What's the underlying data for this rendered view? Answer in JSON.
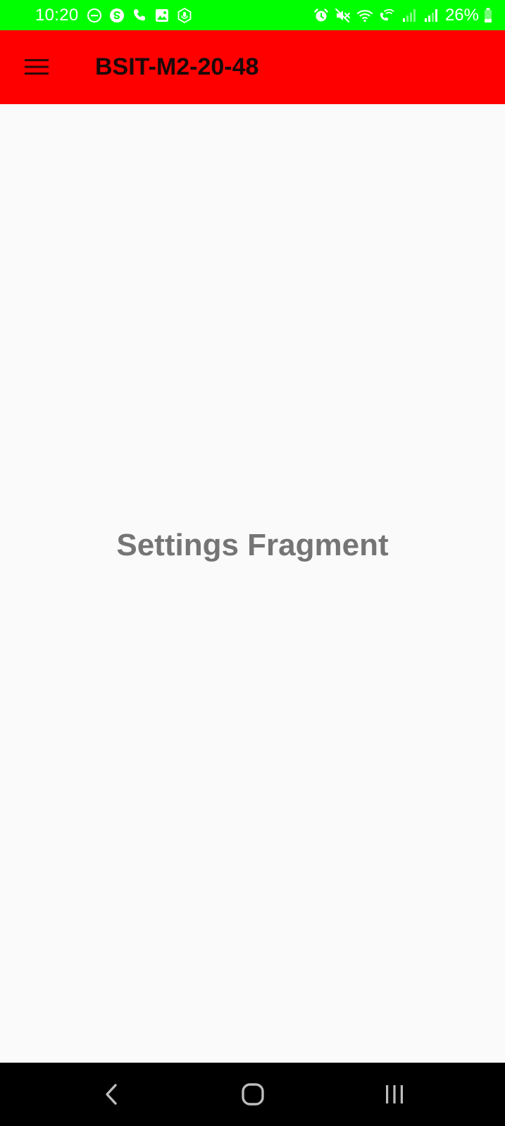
{
  "status_bar": {
    "time": "10:20",
    "battery_percent": "26%",
    "left_icons": [
      "do-not-disturb-icon",
      "skype-icon",
      "phone-call-icon",
      "gallery-icon",
      "voice-recorder-icon"
    ],
    "right_icons": [
      "alarm-icon",
      "mute-icon",
      "wifi-icon",
      "wifi-calling-icon",
      "signal-icon",
      "signal-icon",
      "battery-icon"
    ],
    "background_color": "#00ff00"
  },
  "app_bar": {
    "title": "BSIT-M2-20-48",
    "background_color": "#ff0000",
    "menu_icon": "hamburger-menu-icon"
  },
  "content": {
    "label": "Settings Fragment",
    "label_color": "#757575"
  },
  "nav_bar": {
    "buttons": [
      "back-icon",
      "home-icon",
      "recents-icon"
    ]
  }
}
